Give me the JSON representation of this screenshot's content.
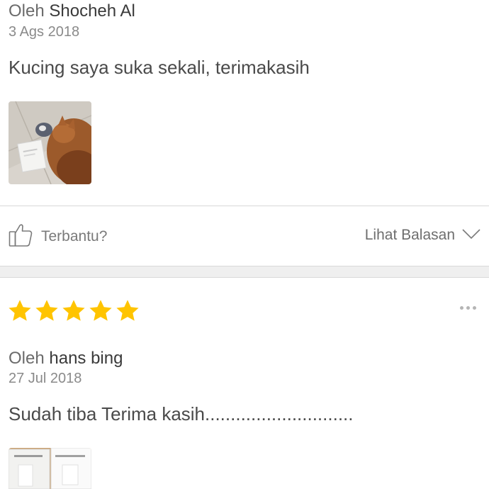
{
  "review1": {
    "by_label": "Oleh",
    "author": "Shocheh Al",
    "date": "3 Ags 2018",
    "text": "Kucing saya suka sekali, terimakasih",
    "photo_icon": "cat-with-charger-photo"
  },
  "actions": {
    "helpful_label": "Terbantu?",
    "helpful_icon": "thumbs-up-icon",
    "replies_label": "Lihat Balasan",
    "replies_icon": "chevron-down-icon"
  },
  "review2": {
    "rating": 5,
    "rating_max": 5,
    "more_icon": "more-options-icon",
    "by_label": "Oleh",
    "author": "hans bing",
    "date": "27 Jul 2018",
    "text": "Sudah tiba Terima kasih.............................",
    "photo_icon": "product-box-photo"
  },
  "colors": {
    "star": "#FFC400",
    "divider": "#d9d9d9",
    "section_gap": "#efefef"
  }
}
